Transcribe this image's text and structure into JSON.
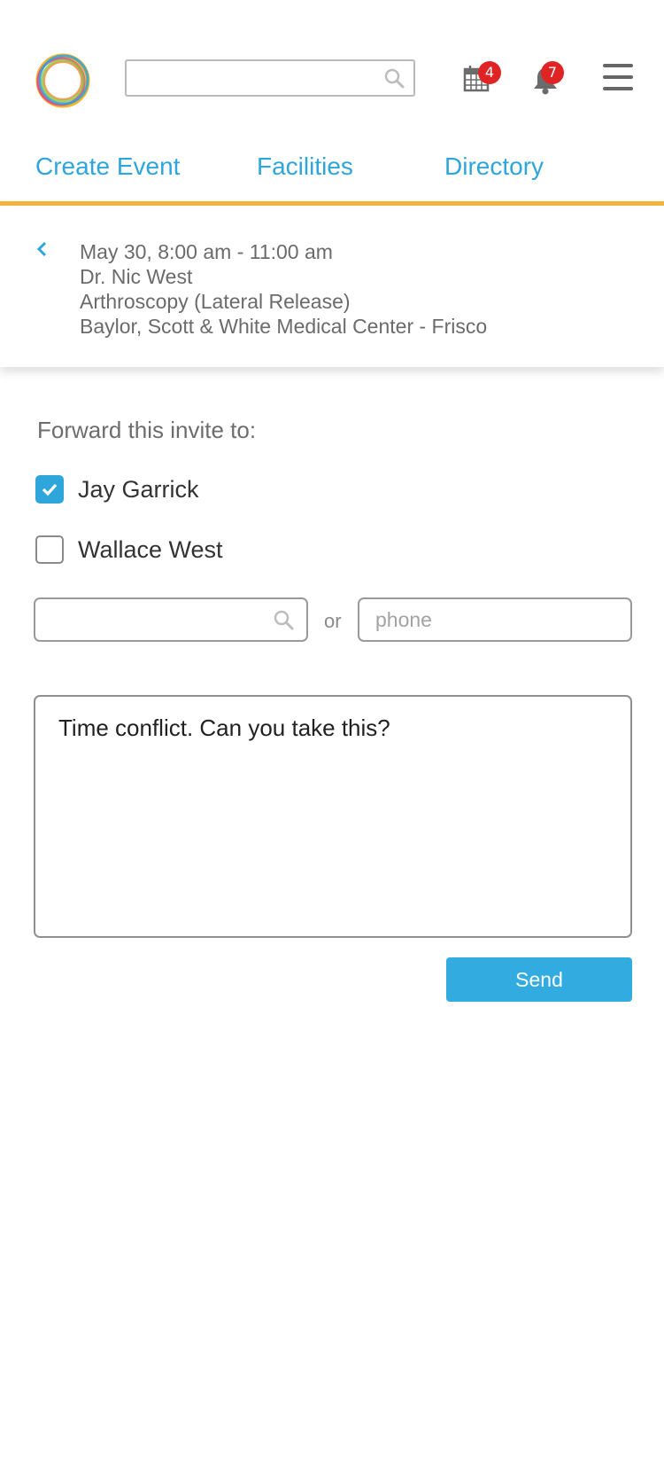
{
  "header": {
    "search_placeholder": "",
    "calendar_badge": "4",
    "notification_badge": "7"
  },
  "nav": {
    "items": [
      {
        "label": "Create Event"
      },
      {
        "label": "Facilities"
      },
      {
        "label": "Directory"
      }
    ]
  },
  "event": {
    "datetime": "May 30, 8:00 am - 11:00 am",
    "doctor": "Dr. Nic West",
    "procedure": "Arthroscopy (Lateral Release)",
    "location": "Baylor, Scott & White Medical Center - Frisco"
  },
  "forward": {
    "label": "Forward this invite to:",
    "recipients": [
      {
        "name": "Jay Garrick",
        "checked": true
      },
      {
        "name": "Wallace West",
        "checked": false
      }
    ],
    "search_placeholder": "",
    "or_text": "or",
    "phone_placeholder": "phone"
  },
  "message": {
    "text": "Time conflict. Can you take this?"
  },
  "actions": {
    "send_label": "Send"
  },
  "colors": {
    "accent": "#2ea6dc",
    "nav_underline": "#f5b43c",
    "badge": "#e02424"
  }
}
